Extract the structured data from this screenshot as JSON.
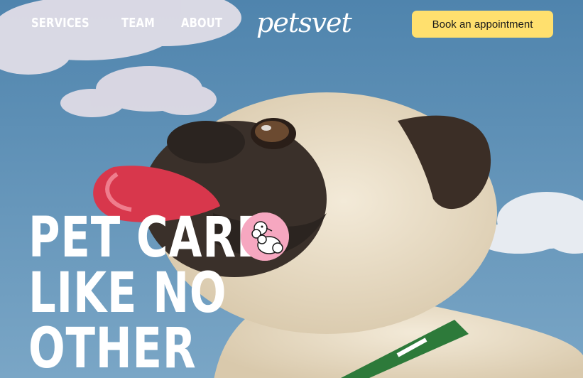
{
  "nav": {
    "items": [
      {
        "label": "SERVICES"
      },
      {
        "label": "TEAM"
      },
      {
        "label": "ABOUT"
      }
    ]
  },
  "brand": {
    "logo_text": "petsvet"
  },
  "header": {
    "cta_label": "Book an appointment"
  },
  "hero": {
    "headline_lines": [
      "PET CARE",
      "LIKE NO",
      "OTHER"
    ],
    "image": "pug-dog-photo",
    "badge_icon": "poodle-icon"
  },
  "colors": {
    "sky": "#5c8db3",
    "cta": "#ffe06e",
    "badge": "#f6a7c0",
    "text": "#ffffff"
  }
}
